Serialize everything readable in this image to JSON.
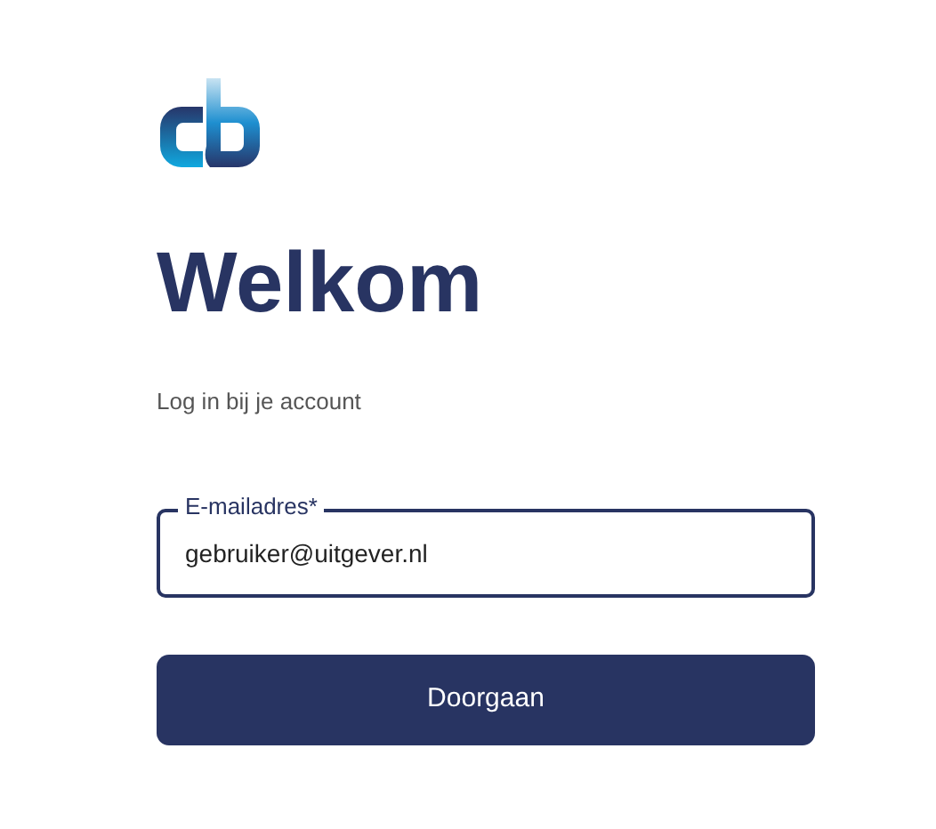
{
  "title": "Welkom",
  "subtitle": "Log in bij je account",
  "email_field": {
    "label": "E-mailadres*",
    "value": "gebruiker@uitgever.nl"
  },
  "buttons": [
    "Doorgaan"
  ]
}
